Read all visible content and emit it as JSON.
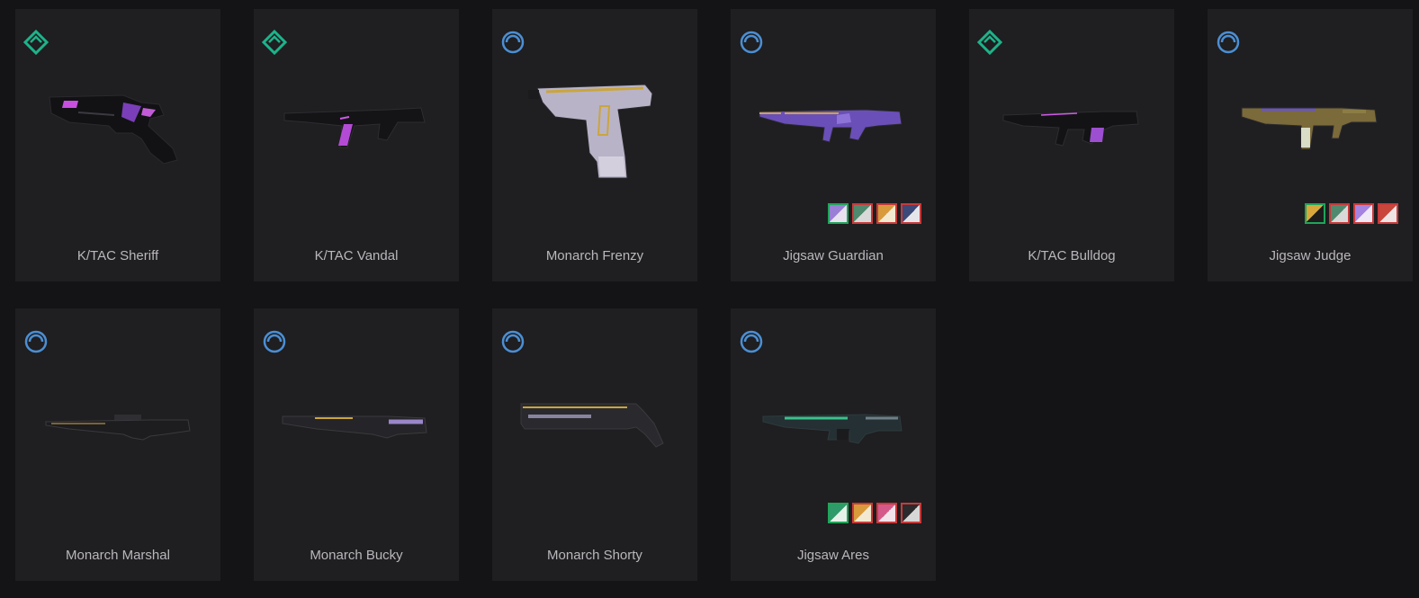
{
  "skins": [
    {
      "name": "K/TAC Sheriff",
      "tier_icon": "select-edition-icon",
      "tier_color": "#1db38a",
      "weapon_icon": "sheriff-pistol-icon",
      "chromas": []
    },
    {
      "name": "K/TAC Vandal",
      "tier_icon": "select-edition-icon",
      "tier_color": "#1db38a",
      "weapon_icon": "vandal-rifle-icon",
      "chromas": []
    },
    {
      "name": "Monarch Frenzy",
      "tier_icon": "deluxe-edition-icon",
      "tier_color": "#4b8fd4",
      "weapon_icon": "frenzy-pistol-icon",
      "chromas": []
    },
    {
      "name": "Jigsaw Guardian",
      "tier_icon": "deluxe-edition-icon",
      "tier_color": "#4b8fd4",
      "weapon_icon": "guardian-rifle-icon",
      "chromas": [
        {
          "colors": [
            "#9a7fd6",
            "#e8e2f0"
          ],
          "active": true
        },
        {
          "colors": [
            "#4f8a6e",
            "#d9d9d9"
          ],
          "active": false
        },
        {
          "colors": [
            "#d89a3a",
            "#f3e9d0"
          ],
          "active": false
        },
        {
          "colors": [
            "#3b4a79",
            "#e6e6ea"
          ],
          "active": false
        }
      ]
    },
    {
      "name": "K/TAC Bulldog",
      "tier_icon": "select-edition-icon",
      "tier_color": "#1db38a",
      "weapon_icon": "bulldog-rifle-icon",
      "chromas": []
    },
    {
      "name": "Jigsaw Judge",
      "tier_icon": "deluxe-edition-icon",
      "tier_color": "#4b8fd4",
      "weapon_icon": "judge-shotgun-icon",
      "chromas": [
        {
          "colors": [
            "#d8a83c",
            "#1d1d1d"
          ],
          "active": true
        },
        {
          "colors": [
            "#4f8a6e",
            "#d9d9d9"
          ],
          "active": false
        },
        {
          "colors": [
            "#a583e0",
            "#efe8f7"
          ],
          "active": false
        },
        {
          "colors": [
            "#c8463a",
            "#f0e3e3"
          ],
          "active": false
        }
      ]
    },
    {
      "name": "Monarch Marshal",
      "tier_icon": "deluxe-edition-icon",
      "tier_color": "#4b8fd4",
      "weapon_icon": "marshal-sniper-icon",
      "chromas": []
    },
    {
      "name": "Monarch Bucky",
      "tier_icon": "deluxe-edition-icon",
      "tier_color": "#4b8fd4",
      "weapon_icon": "bucky-shotgun-icon",
      "chromas": []
    },
    {
      "name": "Monarch Shorty",
      "tier_icon": "deluxe-edition-icon",
      "tier_color": "#4b8fd4",
      "weapon_icon": "shorty-shotgun-icon",
      "chromas": []
    },
    {
      "name": "Jigsaw Ares",
      "tier_icon": "deluxe-edition-icon",
      "tier_color": "#4b8fd4",
      "weapon_icon": "ares-machinegun-icon",
      "chromas": [
        {
          "colors": [
            "#2f9b6a",
            "#e7f1ea"
          ],
          "active": true
        },
        {
          "colors": [
            "#d89a3a",
            "#f3e9d0"
          ],
          "active": false
        },
        {
          "colors": [
            "#d4598a",
            "#f2e2ea"
          ],
          "active": false
        },
        {
          "colors": [
            "#2b2b2e",
            "#d7d7d7"
          ],
          "active": false
        }
      ]
    }
  ]
}
